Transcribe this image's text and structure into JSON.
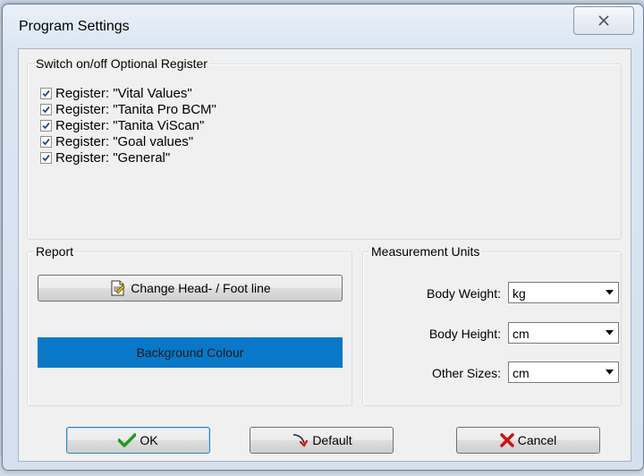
{
  "window": {
    "title": "Program Settings"
  },
  "registers": {
    "legend": "Switch on/off Optional Register",
    "items": [
      {
        "label": "Register: \"Vital Values\"",
        "checked": true
      },
      {
        "label": "Register: \"Tanita Pro BCM\"",
        "checked": true
      },
      {
        "label": "Register: \"Tanita ViScan\"",
        "checked": true
      },
      {
        "label": "Register: \"Goal values\"",
        "checked": true
      },
      {
        "label": "Register: \"General\"",
        "checked": true
      }
    ]
  },
  "report": {
    "legend": "Report",
    "head_foot_label": "Change Head- / Foot line",
    "background_label": "Background Colour",
    "background_color": "#0a78c8"
  },
  "units": {
    "legend": "Measurement Units",
    "body_weight": {
      "label": "Body Weight:",
      "value": "kg"
    },
    "body_height": {
      "label": "Body Height:",
      "value": "cm"
    },
    "other_sizes": {
      "label": "Other Sizes:",
      "value": "cm"
    }
  },
  "actions": {
    "ok_label": "OK",
    "default_label": "Default",
    "cancel_label": "Cancel"
  }
}
